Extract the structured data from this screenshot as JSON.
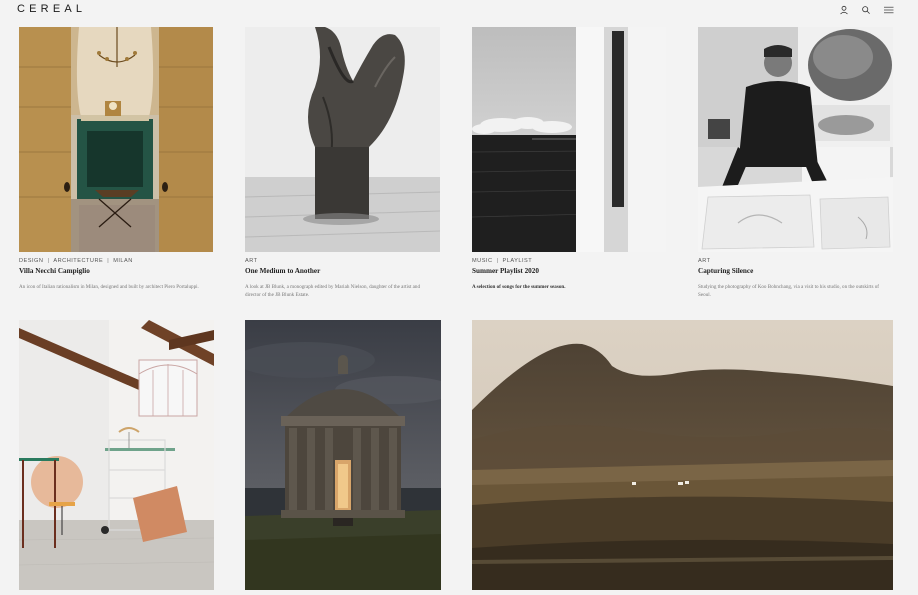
{
  "site": {
    "logo": "CEREAL"
  },
  "header": {
    "icons": [
      "user-icon",
      "search-icon",
      "menu-icon"
    ]
  },
  "articles": [
    {
      "categories": [
        "DESIGN",
        "ARCHITECTURE",
        "MILAN"
      ],
      "title": "Villa Necchi Campiglio",
      "description": "An icon of Italian rationalism in Milan, designed and built by architect Piero Portaluppi."
    },
    {
      "categories": [
        "ART"
      ],
      "title": "One Medium to Another",
      "description": "A look at JB Blunk, a monograph edited by Mariah Nielson, daughter of the artist and director of the JB Blunk Estate."
    },
    {
      "categories": [
        "MUSIC",
        "PLAYLIST"
      ],
      "title": "Summer Playlist 2020",
      "description": "A selection of songs for the summer season."
    },
    {
      "categories": [
        "ART"
      ],
      "title": "Capturing Silence",
      "description": "Studying the photography of Koo Bohnchang, via a visit to his studio, on the outskirts of Seoul."
    }
  ],
  "separator": "|",
  "colors": {
    "background": "#f3f3f3",
    "text": "#2a2a2a",
    "muted": "#777777"
  }
}
